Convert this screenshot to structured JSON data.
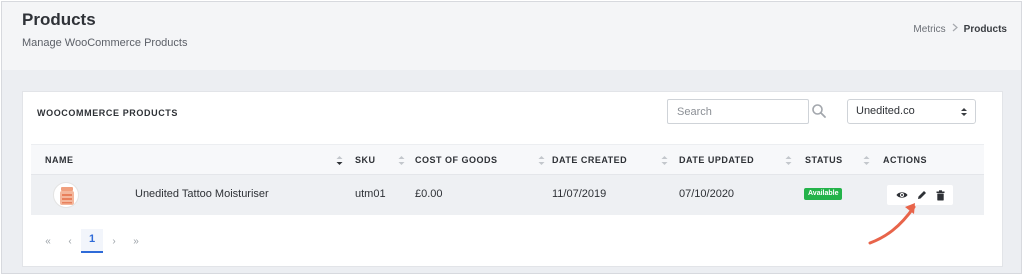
{
  "header": {
    "title": "Products",
    "subtitle": "Manage WooCommerce Products",
    "breadcrumb": [
      "Metrics",
      "Products"
    ]
  },
  "card": {
    "title": "WOOCOMMERCE PRODUCTS",
    "search": {
      "placeholder": "Search",
      "value": ""
    },
    "store_select": {
      "value": "Unedited.co"
    }
  },
  "table": {
    "columns": [
      "NAME",
      "SKU",
      "COST OF GOODS",
      "DATE CREATED",
      "DATE UPDATED",
      "STATUS",
      "ACTIONS"
    ],
    "rows": [
      {
        "name": "Unedited Tattoo Moisturiser",
        "sku": "utm01",
        "cost": "£0.00",
        "created": "11/07/2019",
        "updated": "07/10/2020",
        "status": "Available",
        "actions": [
          "view-icon",
          "edit-icon",
          "delete-icon"
        ]
      }
    ]
  },
  "pagination": {
    "first": "«",
    "prev": "‹",
    "current": "1",
    "next": "›",
    "last": "»"
  },
  "colors": {
    "accent": "#2f6bd8",
    "status_available": "#24b34a",
    "annotation_arrow": "#e8644a"
  }
}
